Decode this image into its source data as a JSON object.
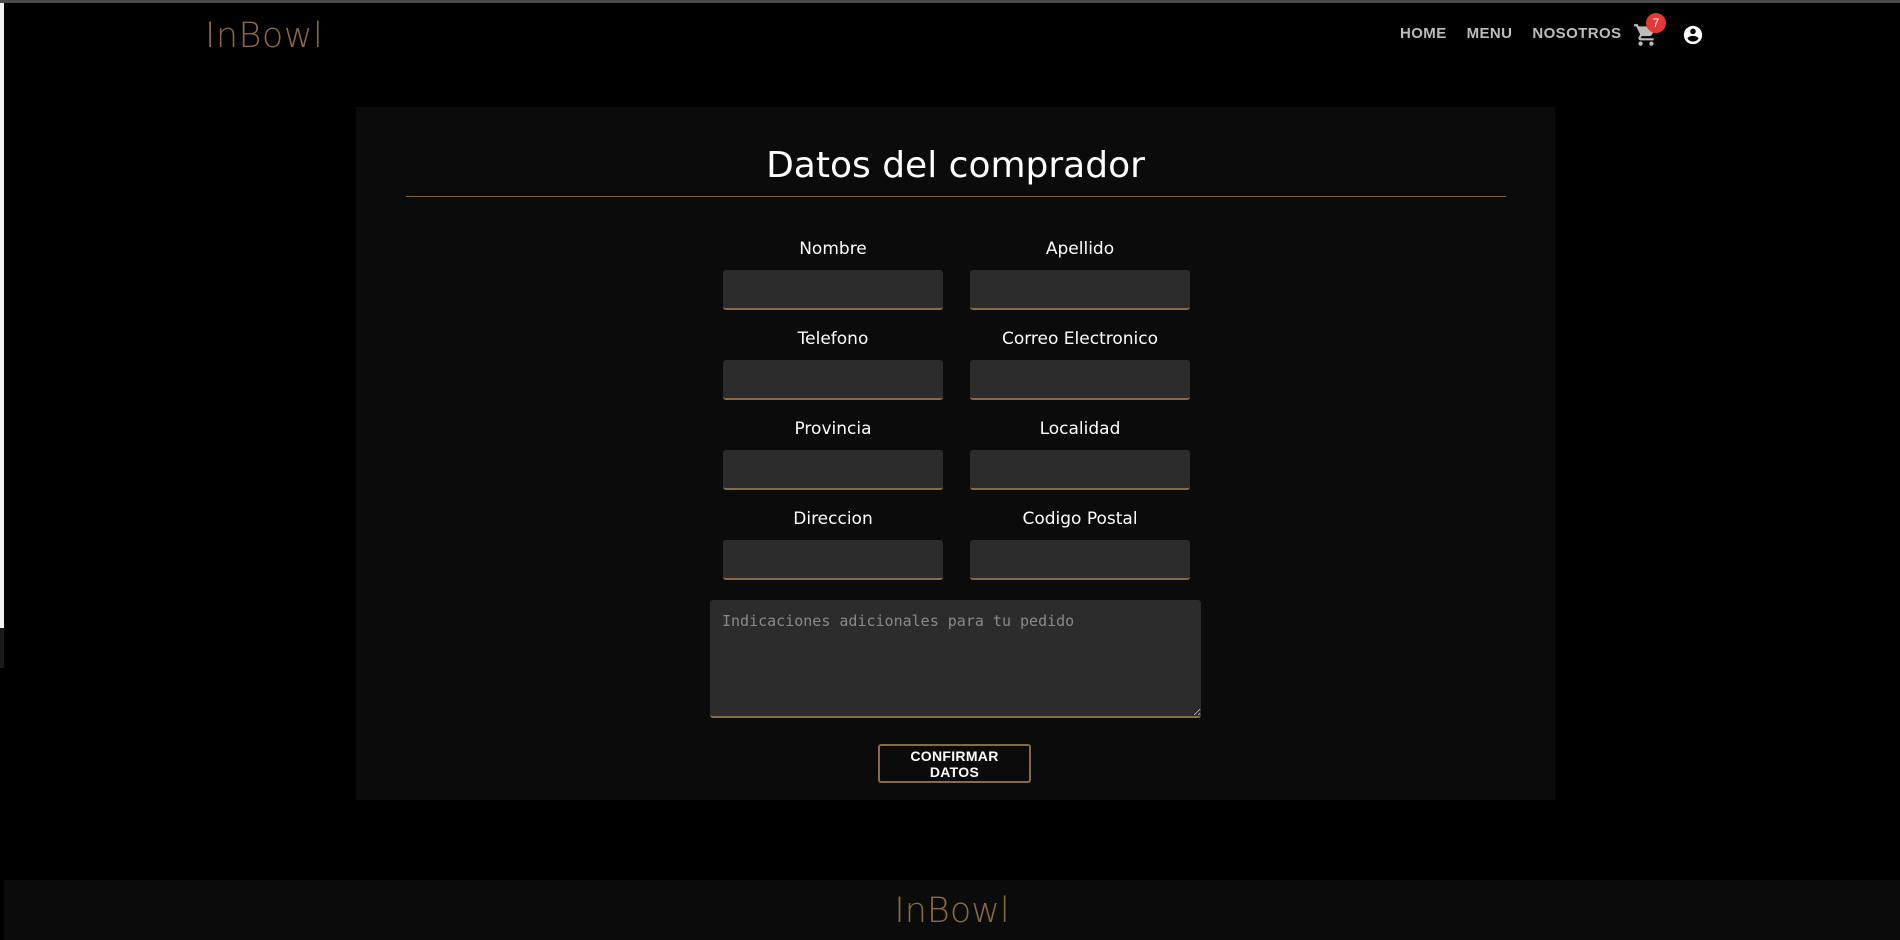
{
  "navbar": {
    "brand": "InBowl",
    "links": [
      "HOME",
      "MENU",
      "NOSOTROS"
    ],
    "cart_icon": "shopping-cart-icon",
    "cart_count": "7",
    "account_icon": "account-circle-icon"
  },
  "form": {
    "title": "Datos del comprador",
    "fields": {
      "nombre": {
        "label": "Nombre",
        "value": ""
      },
      "apellido": {
        "label": "Apellido",
        "value": ""
      },
      "telefono": {
        "label": "Telefono",
        "value": ""
      },
      "correo": {
        "label": "Correo Electronico",
        "value": ""
      },
      "provincia": {
        "label": "Provincia",
        "value": ""
      },
      "localidad": {
        "label": "Localidad",
        "value": ""
      },
      "direccion": {
        "label": "Direccion",
        "value": ""
      },
      "codigo_postal": {
        "label": "Codigo Postal",
        "value": ""
      }
    },
    "notes_placeholder": "Indicaciones adicionales para tu pedido",
    "confirm_label": "CONFIRMAR DATOS"
  },
  "footer": {
    "brand": "InBowl"
  },
  "colors": {
    "accent": "#8a6a45",
    "background": "#000000",
    "card": "#0b0b0b",
    "input": "#2c2c2c",
    "badge": "#e53935"
  }
}
